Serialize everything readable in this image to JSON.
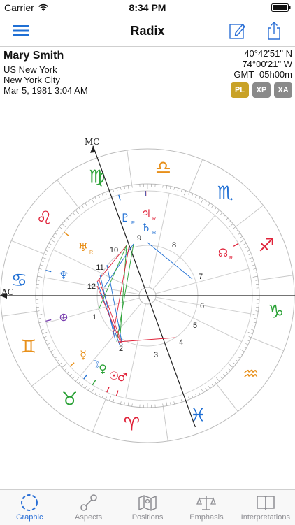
{
  "status": {
    "carrier": "Carrier",
    "time": "8:34 PM"
  },
  "nav": {
    "title": "Radix"
  },
  "person": {
    "name": "Mary Smith",
    "country": "US New York",
    "city": "New York City",
    "datetime": "Mar 5, 1981 3:04 AM",
    "latitude": "40°42'51\" N",
    "longitude": "74°00'21\" W",
    "timezone": "GMT -05h00m"
  },
  "chips": [
    {
      "label": "PL",
      "color": "#c9a227",
      "active": true
    },
    {
      "label": "XP",
      "color": "#8a8a8a",
      "active": false
    },
    {
      "label": "XA",
      "color": "#8a8a8a",
      "active": false
    }
  ],
  "chart": {
    "mc_label": "MC",
    "ac_label": "AC",
    "houses": [
      "1",
      "2",
      "3",
      "4",
      "5",
      "6",
      "7",
      "8",
      "9",
      "10",
      "11",
      "12"
    ],
    "signs": [
      {
        "name": "Libra",
        "glyph": "♎",
        "color": "#e8901a"
      },
      {
        "name": "Virgo",
        "glyph": "♍",
        "color": "#2aa136"
      },
      {
        "name": "Leo",
        "glyph": "♌",
        "color": "#e0233a"
      },
      {
        "name": "Cancer",
        "glyph": "♋",
        "color": "#1f6fd4"
      },
      {
        "name": "Gemini",
        "glyph": "♊",
        "color": "#e8901a"
      },
      {
        "name": "Taurus",
        "glyph": "♉",
        "color": "#2aa136"
      },
      {
        "name": "Aries",
        "glyph": "♈",
        "color": "#e0233a"
      },
      {
        "name": "Pisces",
        "glyph": "♓",
        "color": "#1f6fd4"
      },
      {
        "name": "Aquarius",
        "glyph": "♒",
        "color": "#e8901a"
      },
      {
        "name": "Capricorn",
        "glyph": "♑",
        "color": "#2aa136"
      },
      {
        "name": "Sagittarius",
        "glyph": "♐",
        "color": "#e0233a"
      },
      {
        "name": "Scorpio",
        "glyph": "♏",
        "color": "#1f6fd4"
      }
    ],
    "planets": [
      {
        "name": "Pluto",
        "glyph": "♇",
        "color": "#1f6fd4",
        "retro": "R"
      },
      {
        "name": "Jupiter",
        "glyph": "♃",
        "color": "#e0233a",
        "retro": "R"
      },
      {
        "name": "Saturn",
        "glyph": "♄",
        "color": "#1f6fd4",
        "retro": "R"
      },
      {
        "name": "Uranus",
        "glyph": "♅",
        "color": "#e8901a",
        "retro": "R"
      },
      {
        "name": "North Node",
        "glyph": "☊",
        "color": "#e0233a",
        "retro": "R"
      },
      {
        "name": "Neptune",
        "glyph": "♆",
        "color": "#1f6fd4",
        "retro": ""
      },
      {
        "name": "Part of Fortune",
        "glyph": "⊕",
        "color": "#7a3fb0",
        "retro": ""
      },
      {
        "name": "Mercury",
        "glyph": "☿",
        "color": "#e8901a",
        "retro": ""
      },
      {
        "name": "Moon",
        "glyph": "☽",
        "color": "#1f6fd4",
        "retro": ""
      },
      {
        "name": "Venus",
        "glyph": "♀",
        "color": "#2aa136",
        "retro": ""
      },
      {
        "name": "Sun",
        "glyph": "☉",
        "color": "#e0233a",
        "retro": ""
      },
      {
        "name": "Mars",
        "glyph": "♂",
        "color": "#e0233a",
        "retro": ""
      }
    ]
  },
  "tabs": [
    {
      "label": "Graphic",
      "icon": "circle-dashed-icon",
      "active": true
    },
    {
      "label": "Aspects",
      "icon": "aspects-icon",
      "active": false
    },
    {
      "label": "Positions",
      "icon": "map-icon",
      "active": false
    },
    {
      "label": "Emphasis",
      "icon": "scales-icon",
      "active": false
    },
    {
      "label": "Interpretations",
      "icon": "book-icon",
      "active": false
    }
  ]
}
